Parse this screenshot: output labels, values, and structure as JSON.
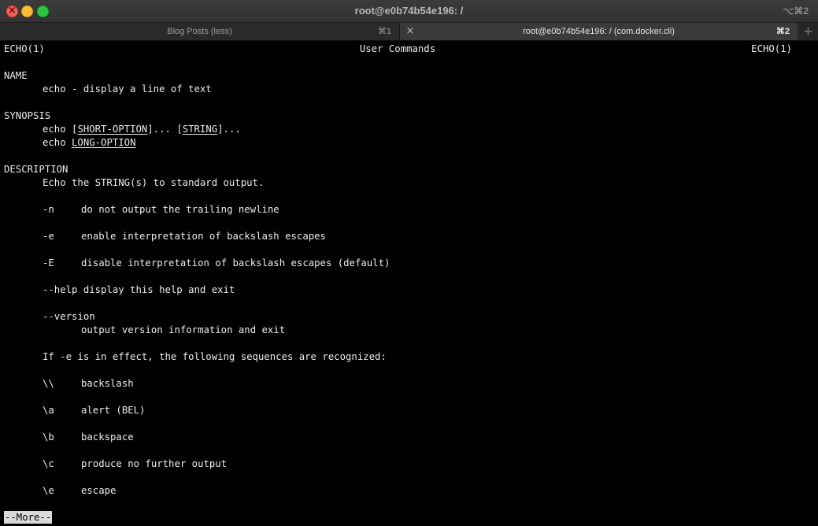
{
  "window": {
    "title": "root@e0b74b54e196: /",
    "shortcut": "⌥⌘2",
    "colors": {
      "close": "#fe5f57",
      "minimize": "#febc2e",
      "maximize": "#28c840"
    }
  },
  "tabs": [
    {
      "label": "Blog Posts (less)",
      "shortcut": "⌘1",
      "active": false
    },
    {
      "label": "root@e0b74b54e196: / (com.docker.cli)",
      "shortcut": "⌘2",
      "active": true
    }
  ],
  "icons": {
    "close_tab": "×",
    "new_tab": "+"
  },
  "man": {
    "header_left": "ECHO(1)",
    "header_center": "User Commands",
    "header_right": "ECHO(1)",
    "name_heading": "NAME",
    "name_text": "echo - display a line of text",
    "synopsis_heading": "SYNOPSIS",
    "synopsis": {
      "cmd": "echo",
      "short_option": "SHORT-OPTION",
      "ellipsis1": "]...",
      "string": "STRING",
      "ellipsis2": "]...",
      "bracket_open": "[",
      "long_option": "LONG-OPTION"
    },
    "description_heading": "DESCRIPTION",
    "description_text": "Echo the STRING(s) to standard output.",
    "options": [
      {
        "flag": "-n",
        "text": "do not output the trailing newline"
      },
      {
        "flag": "-e",
        "text": "enable interpretation of backslash escapes"
      },
      {
        "flag": "-E",
        "text": "disable interpretation of backslash escapes (default)"
      }
    ],
    "help_line": "--help display this help and exit",
    "version_flag": "--version",
    "version_text": "output version information and exit",
    "escape_intro": "If -e is in effect, the following sequences are recognized:",
    "escapes": [
      {
        "seq": "\\\\",
        "text": "backslash"
      },
      {
        "seq": "\\a",
        "text": "alert (BEL)"
      },
      {
        "seq": "\\b",
        "text": "backspace"
      },
      {
        "seq": "\\c",
        "text": "produce no further output"
      },
      {
        "seq": "\\e",
        "text": "escape"
      }
    ]
  },
  "pager": {
    "prompt": "--More--"
  }
}
